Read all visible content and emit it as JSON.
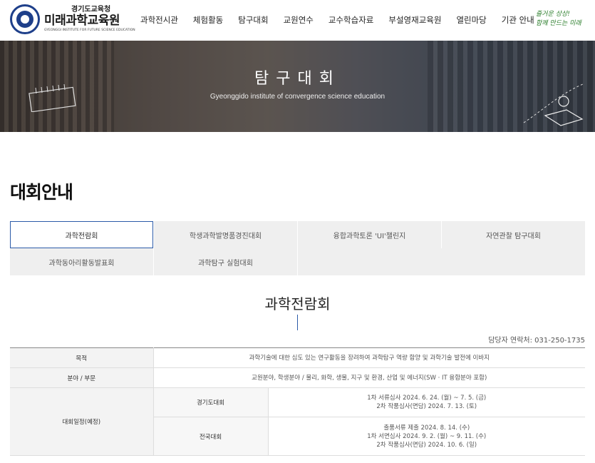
{
  "header": {
    "logo_small": "경기도교육청",
    "logo_main": "미래과학교육원",
    "logo_sub": "GYEONGGI INSTITUTE FOR FUTURE SCIENCE EDUCATION",
    "nav": [
      "과학전시관",
      "체험활동",
      "탐구대회",
      "교원연수",
      "교수학습자료",
      "부설영재교육원",
      "열린마당",
      "기관 안내"
    ],
    "slogan_line1": "즐거운 상상!",
    "slogan_line2": "함께 만드는 미래"
  },
  "banner": {
    "title": "탐구대회",
    "subtitle": "Gyeonggido institute of convergence science education"
  },
  "page_title": "대회안내",
  "tabs": [
    {
      "label": "과학전람회",
      "active": true
    },
    {
      "label": "학생과학발명품경진대회",
      "active": false
    },
    {
      "label": "융합과학토론 'UI'챌린지",
      "active": false
    },
    {
      "label": "자연관찰 탐구대회",
      "active": false
    },
    {
      "label": "과학동아리활동발표회",
      "active": false
    },
    {
      "label": "과학탐구 실험대회",
      "active": false
    }
  ],
  "section": {
    "title": "과학전람회",
    "contact": "담당자 연락처: 031-250-1735"
  },
  "table": {
    "purpose_label": "목적",
    "purpose_value": "과학기술에 대한 심도 있는 연구활동을 장려하여 과학탐구 역량 함양 및 과학기술 발전에 이바지",
    "field_label": "분야 / 부문",
    "field_value": "교원분야, 학생분야 / 물리, 화학, 생물, 지구 및 환경, 산업 및 에너지(SW · IT 융합분야 포함)",
    "schedule_label": "대회일정(예정)",
    "gyeonggi_label": "경기도대회",
    "gyeonggi_lines": [
      "1차 서류심사 2024. 6. 24. (월) ~ 7. 5. (금)",
      "2차 작품심사(면담) 2024. 7. 13. (토)"
    ],
    "national_label": "전국대회",
    "national_lines": [
      "출품서류 제출 2024. 8. 14. (수)",
      "1차 서면심사 2024. 9. 2. (월) ~ 9. 11. (수)",
      "2차 작품심사(면담) 2024. 10. 6. (일)"
    ]
  }
}
